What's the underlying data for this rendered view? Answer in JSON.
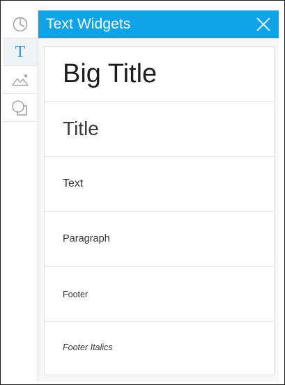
{
  "sidebar": {
    "items": [
      {
        "icon": "clock-icon",
        "active": false
      },
      {
        "icon": "text-icon",
        "glyph": "T",
        "active": true
      },
      {
        "icon": "image-icon",
        "active": false
      },
      {
        "icon": "shapes-icon",
        "active": false
      }
    ]
  },
  "panel": {
    "title": "Text Widgets",
    "close_icon": "close-icon",
    "header_color": "#0ea3e6",
    "accent_color": "#2a9fd8"
  },
  "widgets": [
    {
      "label": "Big Title"
    },
    {
      "label": "Title"
    },
    {
      "label": "Text"
    },
    {
      "label": "Paragraph"
    },
    {
      "label": "Footer"
    },
    {
      "label": "Footer Italics"
    }
  ]
}
